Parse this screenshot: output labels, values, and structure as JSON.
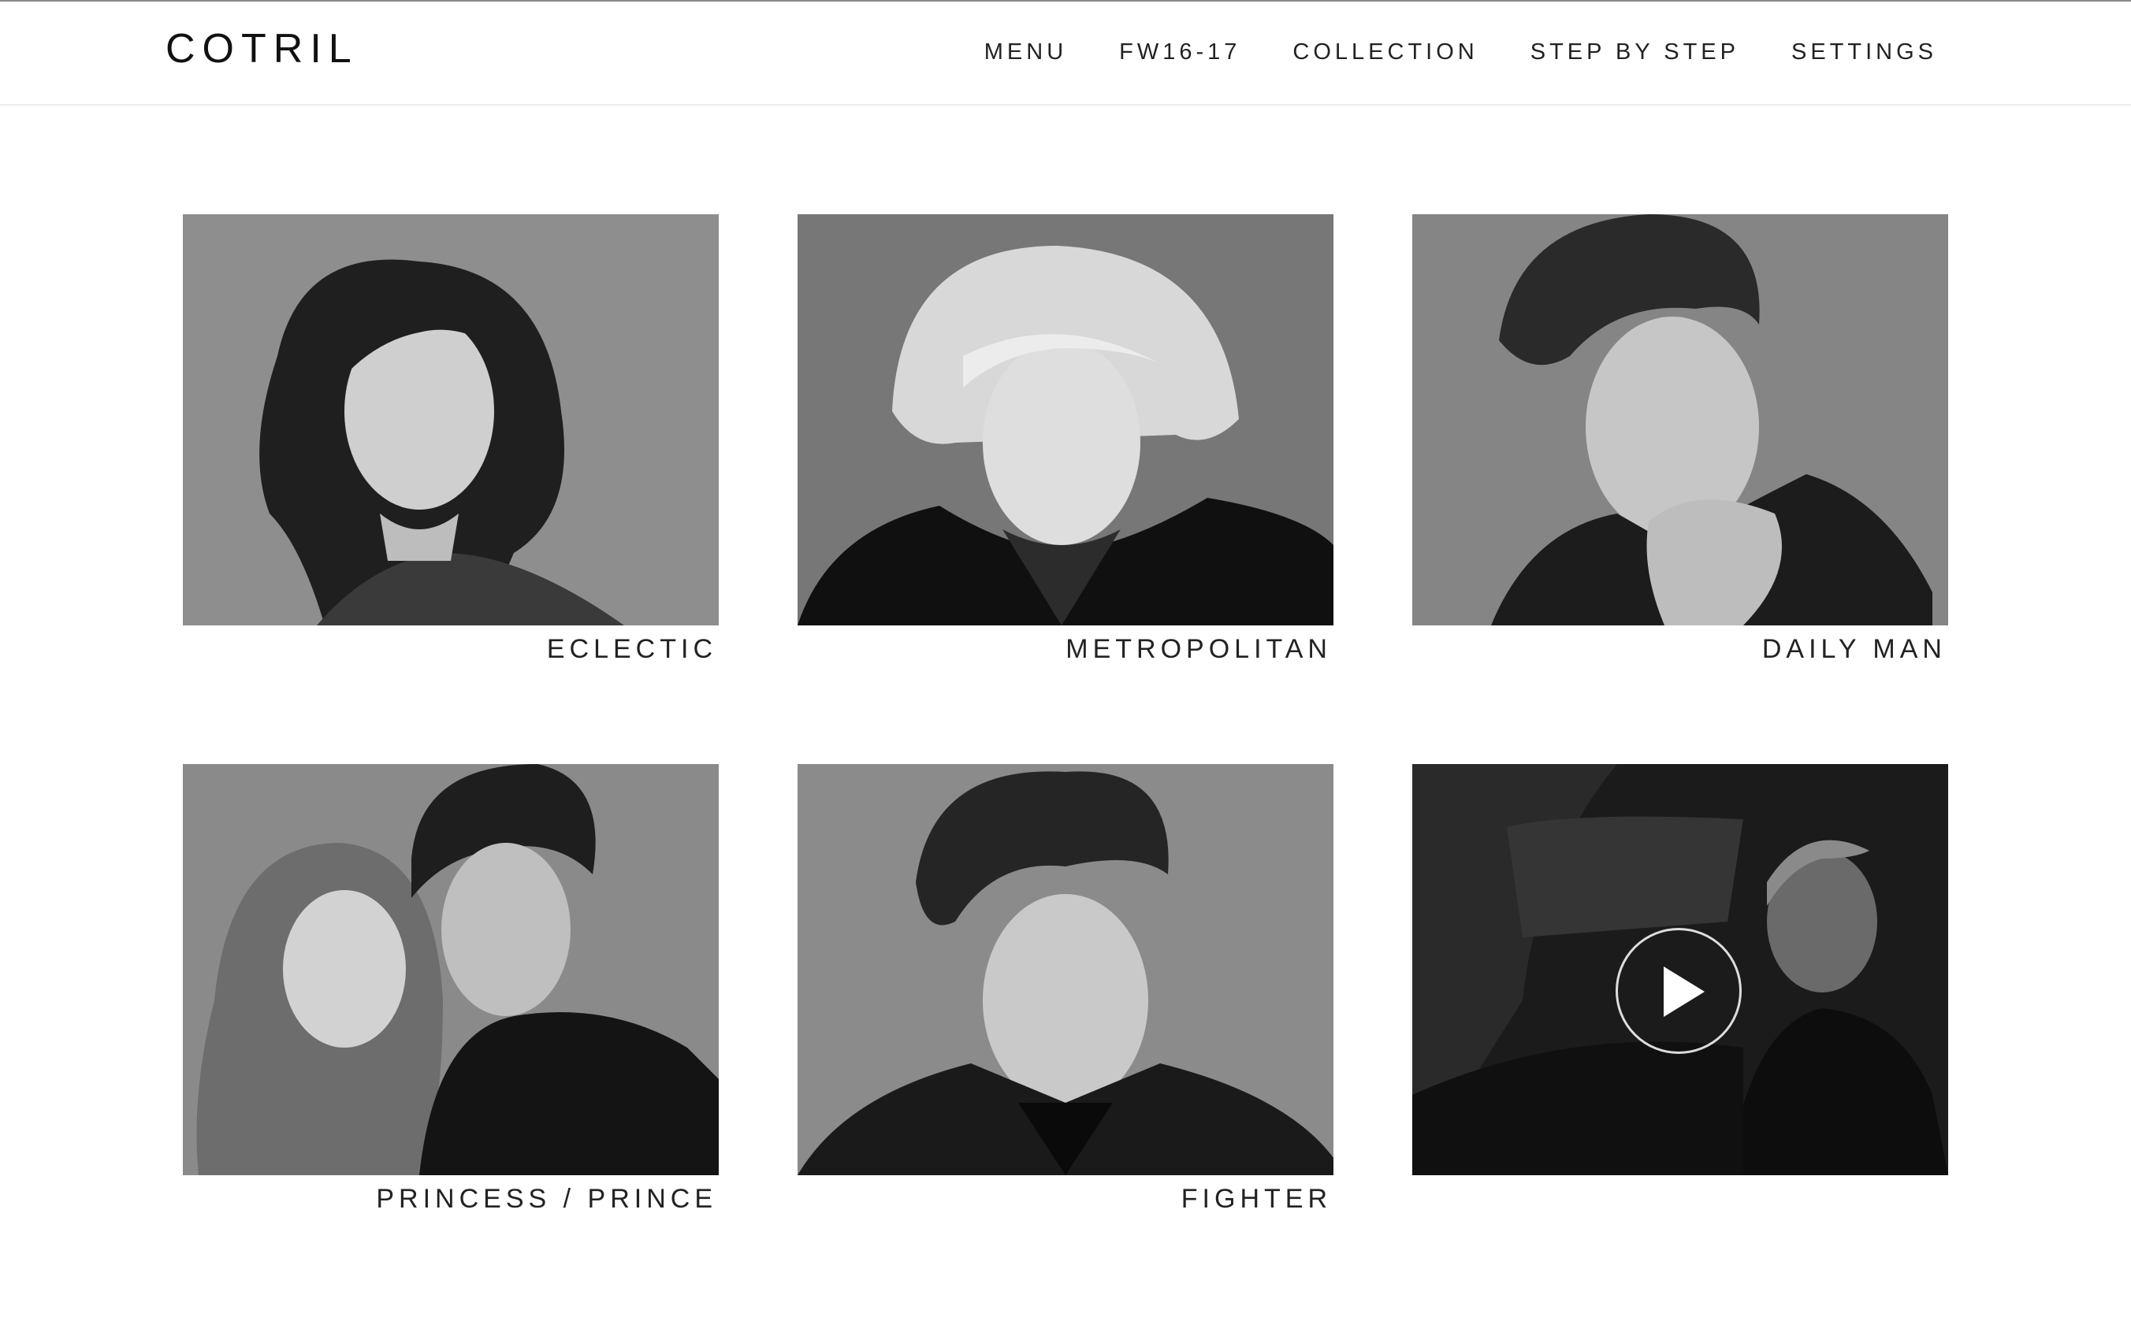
{
  "brand": {
    "name": "COTRIL"
  },
  "nav": {
    "items": [
      {
        "label": "MENU"
      },
      {
        "label": "FW16-17"
      },
      {
        "label": "COLLECTION"
      },
      {
        "label": "STEP BY STEP"
      },
      {
        "label": "SETTINGS"
      }
    ]
  },
  "gallery": {
    "cards": [
      {
        "caption": "ECLECTIC"
      },
      {
        "caption": "METROPOLITAN"
      },
      {
        "caption": "DAILY MAN"
      },
      {
        "caption": "PRINCESS / PRINCE"
      },
      {
        "caption": "FIGHTER"
      },
      {
        "caption": "",
        "icon": "play-icon"
      }
    ]
  },
  "colors": {
    "text": "#1a1a1a",
    "photo_bg": "#8c8c8c",
    "video_bg": "#1c1c1c"
  }
}
